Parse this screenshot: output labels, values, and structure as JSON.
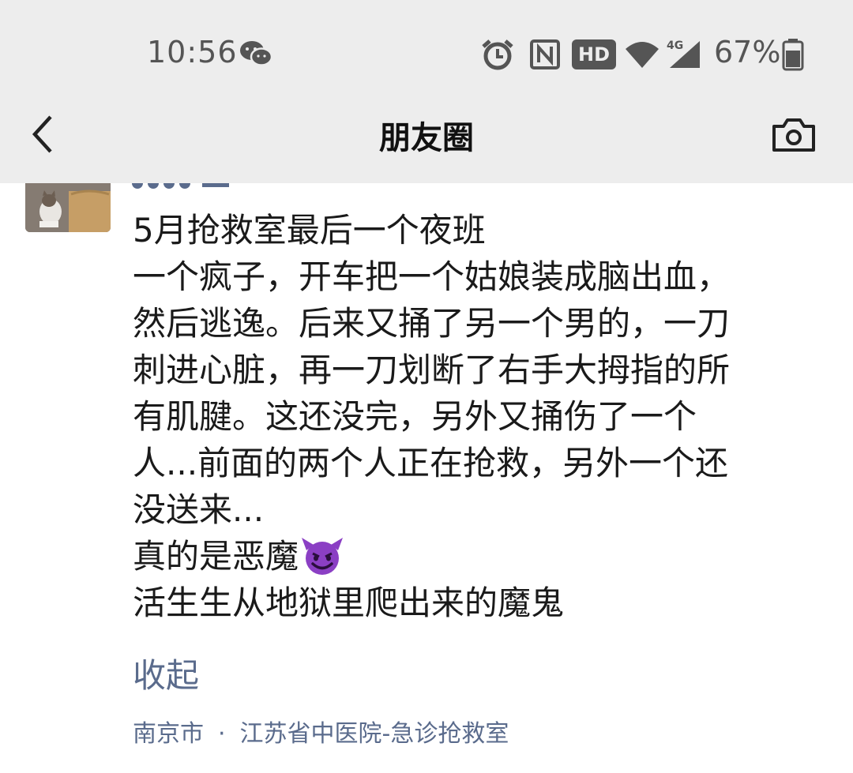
{
  "status_bar": {
    "time": "10:56",
    "icons": [
      "wechat-icon",
      "alarm-icon",
      "nfc-icon",
      "hd-icon",
      "wifi-icon",
      "signal-4g-icon",
      "battery-icon"
    ],
    "hd_label": "HD",
    "network_label": "4G",
    "battery_percent": "67%"
  },
  "nav": {
    "title": "朋友圈",
    "back_icon": "chevron-left-icon",
    "camera_icon": "camera-icon"
  },
  "post": {
    "lines": [
      "5月抢救室最后一个夜班",
      "一个疯子，开车把一个姑娘装成脑出血，",
      "然后逃逸。后来又捅了另一个男的，一刀",
      "刺进心脏，再一刀划断了右手大拇指的所",
      "有肌腱。这还没完，另外又捅伤了一个",
      "人...前面的两个人正在抢救，另外一个还",
      "没送来...",
      "真的是恶魔",
      "活生生从地狱里爬出来的魔鬼"
    ],
    "emoji": "smiling-devil-emoji",
    "collapse_label": "收起",
    "location_city": "南京市",
    "location_separator": "·",
    "location_place": "江苏省中医院-急诊抢救室"
  },
  "colors": {
    "header_bg": "#ededed",
    "link_blue": "#5a6b8c",
    "body_text": "#1a1a1a",
    "devil_purple": "#8b3fc4"
  }
}
